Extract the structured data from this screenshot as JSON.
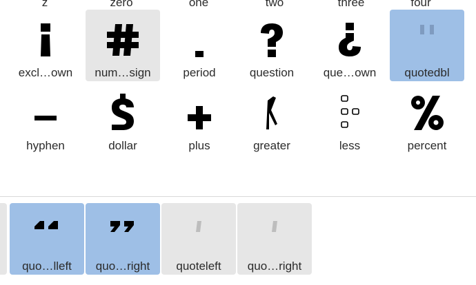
{
  "glyph_grid": {
    "top_row_labels": [
      "z",
      "zero",
      "one",
      "two",
      "three",
      "four"
    ],
    "row1": [
      {
        "label": "excl…own",
        "icon": "exclamdown-glyph-icon"
      },
      {
        "label": "num…sign",
        "icon": "numbersign-glyph-icon"
      },
      {
        "label": "period",
        "icon": "period-glyph-icon"
      },
      {
        "label": "question",
        "icon": "question-glyph-icon"
      },
      {
        "label": "que…own",
        "icon": "questiondown-glyph-icon"
      },
      {
        "label": "quotedbl",
        "icon": "quotedbl-glyph-icon"
      }
    ],
    "row1_edge": ",",
    "row2": [
      {
        "label": "hyphen",
        "icon": "hyphen-glyph-icon"
      },
      {
        "label": "dollar",
        "icon": "dollar-glyph-icon"
      },
      {
        "label": "plus",
        "icon": "plus-glyph-icon"
      },
      {
        "label": "greater",
        "icon": "greater-glyph-icon"
      },
      {
        "label": "less",
        "icon": "less-glyph-icon"
      },
      {
        "label": "percent",
        "icon": "percent-glyph-icon"
      }
    ]
  },
  "bottom_strip": {
    "items": [
      {
        "label": "quo…lleft",
        "icon": "quotedblleft-glyph-icon"
      },
      {
        "label": "quo…right",
        "icon": "quotedblright-glyph-icon"
      },
      {
        "label": "quoteleft",
        "icon": "quoteleft-glyph-icon"
      },
      {
        "label": "quo…right",
        "icon": "quoteright-glyph-icon"
      }
    ]
  },
  "colors": {
    "selection_blue": "#9ebfe6",
    "selection_gray": "#e6e6e6",
    "glyph_black": "#000000",
    "glyph_faded": "#7f9bc0"
  }
}
